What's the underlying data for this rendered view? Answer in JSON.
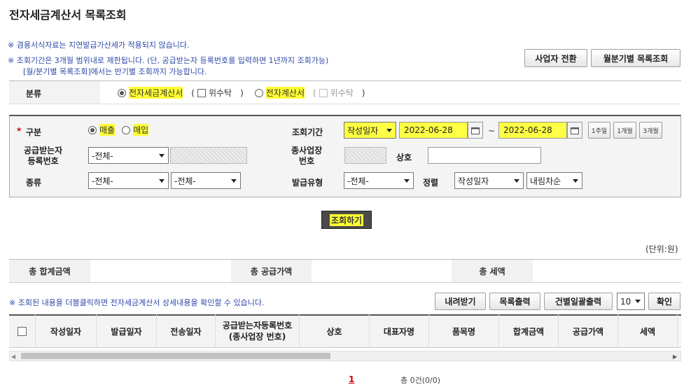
{
  "page": {
    "title": "전자세금계산서 목록조회"
  },
  "notices": {
    "line1": "※ 겸용서식자료는 지연발급가산세가 적용되지 않습니다.",
    "line2": "※ 조회기간은 3개월 범위내로 제한됩니다. (단, 공급받는자 등록번호를 입력하면 1년까지 조회가능)",
    "line3": "[월/분기별 목록조회]에서는 반기별 조회까지 가능합니다."
  },
  "top_buttons": {
    "switch": "사업자 전환",
    "monthly": "월분기별 목록조회"
  },
  "category": {
    "label": "분류",
    "opt1": "전자세금계산서",
    "opt1_paren_open": "(",
    "opt1_trust": "위수탁",
    "opt1_paren_close": ")",
    "opt2": "전자계산서",
    "opt2_paren_open": "(",
    "opt2_trust": "위수탁",
    "opt2_paren_close": ")"
  },
  "search": {
    "required_mark": "*",
    "type_label": "구분",
    "sales": "매출",
    "purchase": "매입",
    "period_label": "조회기간",
    "period_select": "작성일자",
    "date_from": "2022-06-28",
    "date_sep": "~",
    "date_to": "2022-06-28",
    "quick": [
      "1주일",
      "1개월",
      "3개월"
    ],
    "buyer_reg_label_1": "공급받는자",
    "buyer_reg_label_2": "등록번호",
    "buyer_reg_select": "-전체-",
    "branch_label_1": "종사업장",
    "branch_label_2": "번호",
    "company_label": "상호",
    "kind_label": "종류",
    "kind_select1": "-전체-",
    "kind_select2": "-전체-",
    "issue_type_label": "발급유형",
    "issue_type_select": "-전체-",
    "sort_label": "정렬",
    "sort_select": "작성일자",
    "order_select": "내림차순",
    "submit": "조회하기"
  },
  "unit": "(단위:원)",
  "totals": {
    "sum_label": "총 합계금액",
    "supply_label": "총 공급가액",
    "tax_label": "총 세액"
  },
  "list_notice": "※ 조회된 내용을 더블클릭하면 전자세금계산서 상세내용을 확인할 수 있습니다.",
  "list_buttons": {
    "download": "내려받기",
    "print": "목록출력",
    "bulk_print": "건별일괄출력",
    "page_size": "10",
    "confirm": "확인"
  },
  "table": {
    "headers": [
      "작성일자",
      "발급일자",
      "전송일자",
      "공급받는자등록번호\n(종사업장 번호)",
      "상호",
      "대표자명",
      "품목명",
      "합계금액",
      "공급가액",
      "세액"
    ]
  },
  "pager": {
    "current": "1",
    "count": "총 0건(0/0)"
  }
}
